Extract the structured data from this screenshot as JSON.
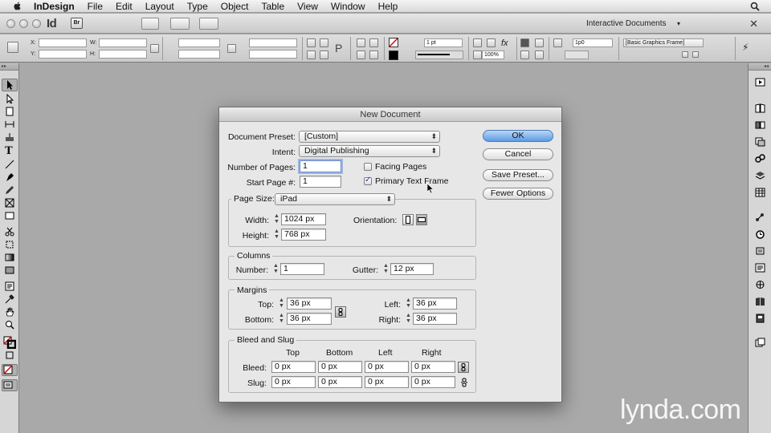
{
  "menubar": {
    "app_name": "InDesign",
    "items": [
      "File",
      "Edit",
      "Layout",
      "Type",
      "Object",
      "Table",
      "View",
      "Window",
      "Help"
    ]
  },
  "appbar": {
    "app_logo": "Id",
    "bridge_label": "Br",
    "workspace": "Interactive Documents"
  },
  "control_panel": {
    "x_label": "X:",
    "y_label": "Y:",
    "w_label": "W:",
    "h_label": "H:",
    "stroke_weight": "1 pt",
    "opacity": "100%",
    "gap_value": "1p0",
    "object_style": "[Basic Graphics Frame]"
  },
  "dialog": {
    "title": "New Document",
    "document_preset_label": "Document Preset:",
    "document_preset_value": "[Custom]",
    "intent_label": "Intent:",
    "intent_value": "Digital Publishing",
    "num_pages_label": "Number of Pages:",
    "num_pages_value": "1",
    "start_page_label": "Start Page #:",
    "start_page_value": "1",
    "facing_pages_label": "Facing Pages",
    "facing_pages_checked": false,
    "primary_text_frame_label": "Primary Text Frame",
    "primary_text_frame_checked": true,
    "page_size_label": "Page Size:",
    "page_size_value": "iPad",
    "width_label": "Width:",
    "width_value": "1024 px",
    "height_label": "Height:",
    "height_value": "768 px",
    "orientation_label": "Orientation:",
    "columns": {
      "title": "Columns",
      "number_label": "Number:",
      "number_value": "1",
      "gutter_label": "Gutter:",
      "gutter_value": "12 px"
    },
    "margins": {
      "title": "Margins",
      "top_label": "Top:",
      "top_value": "36 px",
      "bottom_label": "Bottom:",
      "bottom_value": "36 px",
      "left_label": "Left:",
      "left_value": "36 px",
      "right_label": "Right:",
      "right_value": "36 px"
    },
    "bleed_slug": {
      "title": "Bleed and Slug",
      "col_top": "Top",
      "col_bottom": "Bottom",
      "col_left": "Left",
      "col_right": "Right",
      "bleed_label": "Bleed:",
      "slug_label": "Slug:",
      "bleed_values": [
        "0 px",
        "0 px",
        "0 px",
        "0 px"
      ],
      "slug_values": [
        "0 px",
        "0 px",
        "0 px",
        "0 px"
      ]
    },
    "buttons": {
      "ok": "OK",
      "cancel": "Cancel",
      "save_preset": "Save Preset...",
      "fewer_options": "Fewer Options"
    }
  },
  "watermark": "lynda.com",
  "colors": {
    "pasteboard": "#a9a9a9",
    "dialog_bg": "#e7e7e7",
    "default_button": "#5b9be5",
    "focus_ring": "#9ab6e6"
  }
}
